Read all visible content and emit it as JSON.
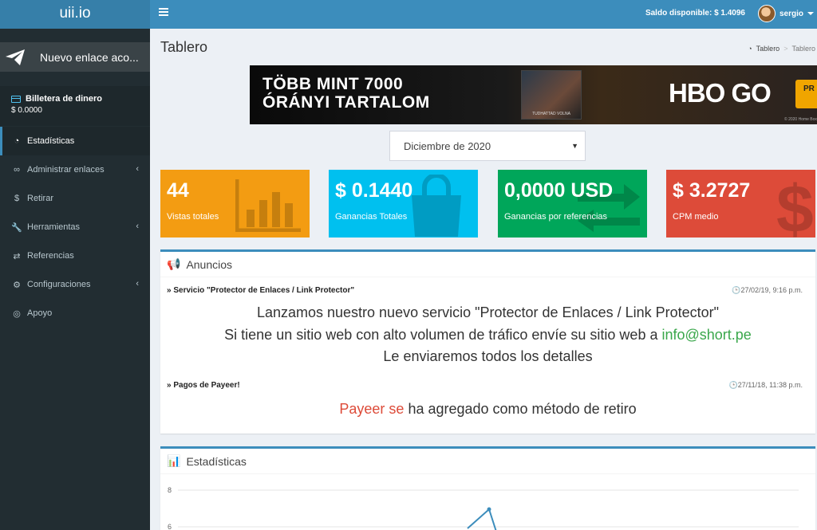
{
  "brand": "uii.io",
  "topbar": {
    "balance": "Saldo disponible: $ 1.4096",
    "username": "sergio"
  },
  "sidebar": {
    "new_link": "Nuevo enlace aco...",
    "wallet_title": "Billetera de dinero",
    "wallet_amount": "$ 0.0000",
    "items": [
      {
        "label": "Estadísticas",
        "icon": "dashboard-icon"
      },
      {
        "label": "Administrar enlaces",
        "icon": "link-icon"
      },
      {
        "label": "Retirar",
        "icon": "dollar-icon"
      },
      {
        "label": "Herramientas",
        "icon": "wrench-icon"
      },
      {
        "label": "Referencias",
        "icon": "exchange-icon"
      },
      {
        "label": "Configuraciones",
        "icon": "cogs-icon"
      },
      {
        "label": "Apoyo",
        "icon": "life-ring-icon"
      }
    ]
  },
  "page": {
    "title": "Tablero",
    "breadcrumb": [
      "Tablero",
      "Tablero"
    ]
  },
  "banner": {
    "headline_1": "TÖBB MINT 7000",
    "headline_2": "ÓRÁNYI TARTALOM",
    "poster_caption": "TUDHATTAD VOLNA",
    "logo": "HBO GO",
    "button": "PR",
    "copyright": "© 2020 Home Box"
  },
  "month_select": "Diciembre de 2020",
  "stats": [
    {
      "value": "44",
      "label": "Vistas totales",
      "color": "#f39c12"
    },
    {
      "value": "$ 0.1440",
      "label": "Ganancias Totales",
      "color": "#00c0ef"
    },
    {
      "value": "0,0000 USD",
      "label": "Ganancias por referencias",
      "color": "#00a65a"
    },
    {
      "value": "$ 3.2727",
      "label": "CPM medio",
      "color": "#dd4b39"
    }
  ],
  "announcements": {
    "title": "Anuncios",
    "items": [
      {
        "title": "Servicio \"Protector de Enlaces / Link Protector\"",
        "date": "27/02/19, 9:16 p.m.",
        "line1": "Lanzamos nuestro nuevo servicio \"Protector de Enlaces / Link Protector\"",
        "line2_text": "Si tiene un sitio web con alto volumen de tráfico envíe  su sitio web a",
        "line2_email": "info@short.pe",
        "line3": "Le enviaremos todos los detalles"
      },
      {
        "title": "Pagos de Payeer!",
        "date": "27/11/18, 11:38 p.m.",
        "highlight": "Payeer se",
        "rest": "ha agregado como método de retiro"
      }
    ]
  },
  "stats_panel": {
    "title": "Estadísticas",
    "y_tick_top": "8",
    "y_tick_2": "6"
  },
  "chart_data": {
    "type": "line",
    "yticks": [
      "8",
      "6"
    ]
  }
}
